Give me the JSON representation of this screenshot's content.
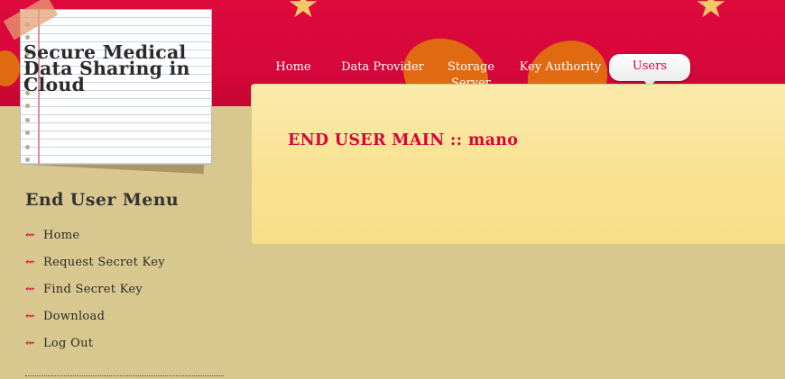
{
  "site": {
    "title": "Secure Medical Data Sharing in Cloud"
  },
  "nav": {
    "items": [
      {
        "label": "Home"
      },
      {
        "label": "Data Provider"
      },
      {
        "label": "Storage Server"
      },
      {
        "label": "Key Authority"
      },
      {
        "label": "Users",
        "active": true
      }
    ]
  },
  "main": {
    "title": "END USER MAIN :: mano"
  },
  "sidebar": {
    "title": "End User Menu",
    "items": [
      {
        "label": "Home"
      },
      {
        "label": "Request Secret Key"
      },
      {
        "label": "Find Secret Key"
      },
      {
        "label": "Download"
      },
      {
        "label": "Log Out"
      }
    ]
  },
  "colors": {
    "header_red": "#d5073a",
    "accent_orange": "#e06a12",
    "background_tan": "#d8c78e",
    "content_yellow": "#f8e190"
  },
  "icons": {
    "menu_bullet": "red-arrow-icon",
    "decoration": "star-icon"
  }
}
